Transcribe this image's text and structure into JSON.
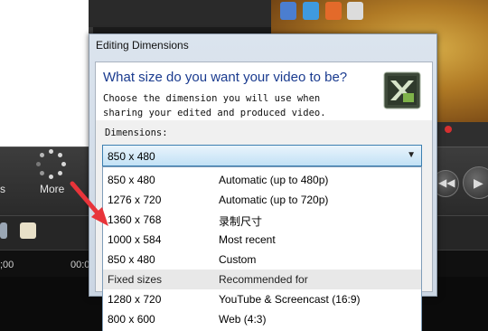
{
  "toolbar": {
    "left_cut_label": "s",
    "more_label": "More"
  },
  "timeline": {
    "ruler_left": ";00",
    "ruler_mid": "00:0"
  },
  "dialog": {
    "title": "Editing Dimensions",
    "question": "What size do you want your video to be?",
    "description": "Choose the dimension you will use when sharing your edited and produced video.",
    "dimensions_label": "Dimensions:",
    "selected_value": "850 x 480"
  },
  "dropdown": {
    "items": [
      {
        "size": "850 x 480",
        "desc": "Automatic (up to 480p)"
      },
      {
        "size": "1276 x 720",
        "desc": "Automatic (up to 720p)"
      },
      {
        "size": "1360 x 768",
        "desc": "录制尺寸"
      },
      {
        "size": "1000 x 584",
        "desc": "Most recent"
      },
      {
        "size": "850 x 480",
        "desc": "Custom"
      }
    ],
    "section_header": {
      "col1": "Fixed sizes",
      "col2": "Recommended for"
    },
    "fixed": [
      {
        "size": "1280 x 720",
        "desc": "YouTube & Screencast (16:9)"
      },
      {
        "size": "800 x 600",
        "desc": "Web (4:3)"
      }
    ]
  },
  "colors": {
    "annotation_arrow": "#e8343a",
    "question_text": "#1a3b8f",
    "select_highlight": "#c2e1f5"
  },
  "icons": [
    "more-icon",
    "dropdown-caret-icon",
    "camtasia-logo-icon",
    "rewind-icon",
    "play-icon"
  ]
}
